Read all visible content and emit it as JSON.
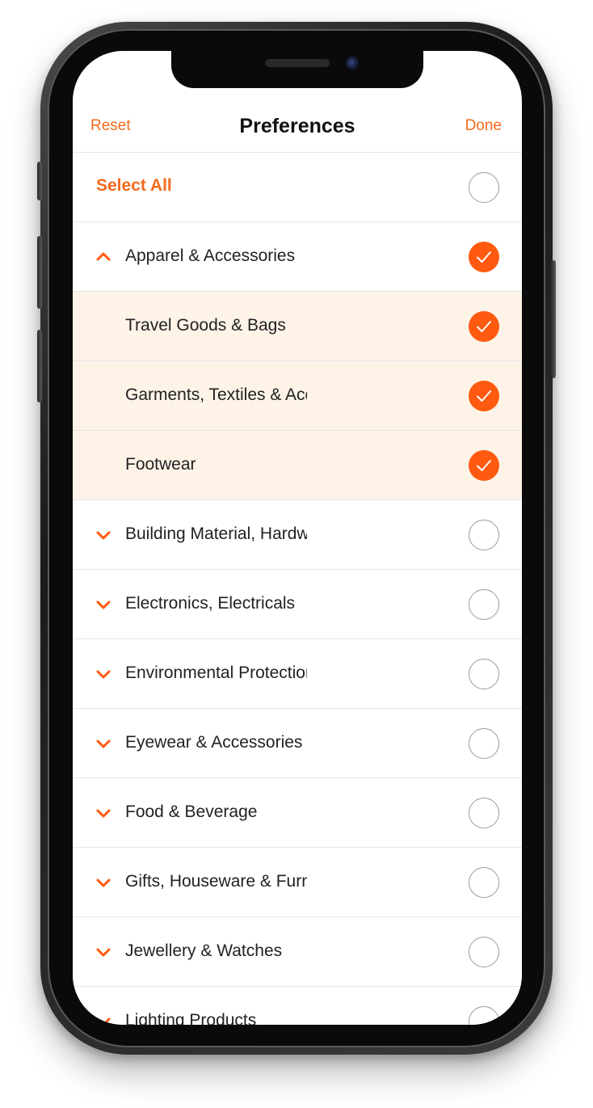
{
  "colors": {
    "accent": "#ff5a10",
    "accent_text": "#f46a1d",
    "sub_row_bg": "#fdf3e7"
  },
  "navbar": {
    "left_label": "Reset",
    "title": "Preferences",
    "right_label": "Done"
  },
  "select_all": {
    "label": "Select All",
    "checked": false
  },
  "categories": [
    {
      "label": "Apparel & Accessories",
      "expanded": true,
      "checked": true,
      "icon": "chevron-up-icon"
    },
    {
      "label": "Travel Goods & Bags",
      "sub": true,
      "checked": true
    },
    {
      "label": "Garments, Textiles & Accessories",
      "sub": true,
      "checked": true
    },
    {
      "label": "Footwear",
      "sub": true,
      "checked": true
    },
    {
      "label": "Building Material, Hardware",
      "expanded": false,
      "checked": false,
      "icon": "chevron-down-icon"
    },
    {
      "label": "Electronics, Electricals",
      "expanded": false,
      "checked": false,
      "icon": "chevron-down-icon"
    },
    {
      "label": "Environmental Protection",
      "expanded": false,
      "checked": false,
      "icon": "chevron-down-icon"
    },
    {
      "label": "Eyewear & Accessories",
      "expanded": false,
      "checked": false,
      "icon": "chevron-down-icon"
    },
    {
      "label": "Food & Beverage",
      "expanded": false,
      "checked": false,
      "icon": "chevron-down-icon"
    },
    {
      "label": "Gifts, Houseware & Furniture",
      "expanded": false,
      "checked": false,
      "icon": "chevron-down-icon"
    },
    {
      "label": "Jewellery & Watches",
      "expanded": false,
      "checked": false,
      "icon": "chevron-down-icon"
    },
    {
      "label": "Lighting Products",
      "expanded": false,
      "checked": false,
      "icon": "chevron-down-icon"
    }
  ]
}
